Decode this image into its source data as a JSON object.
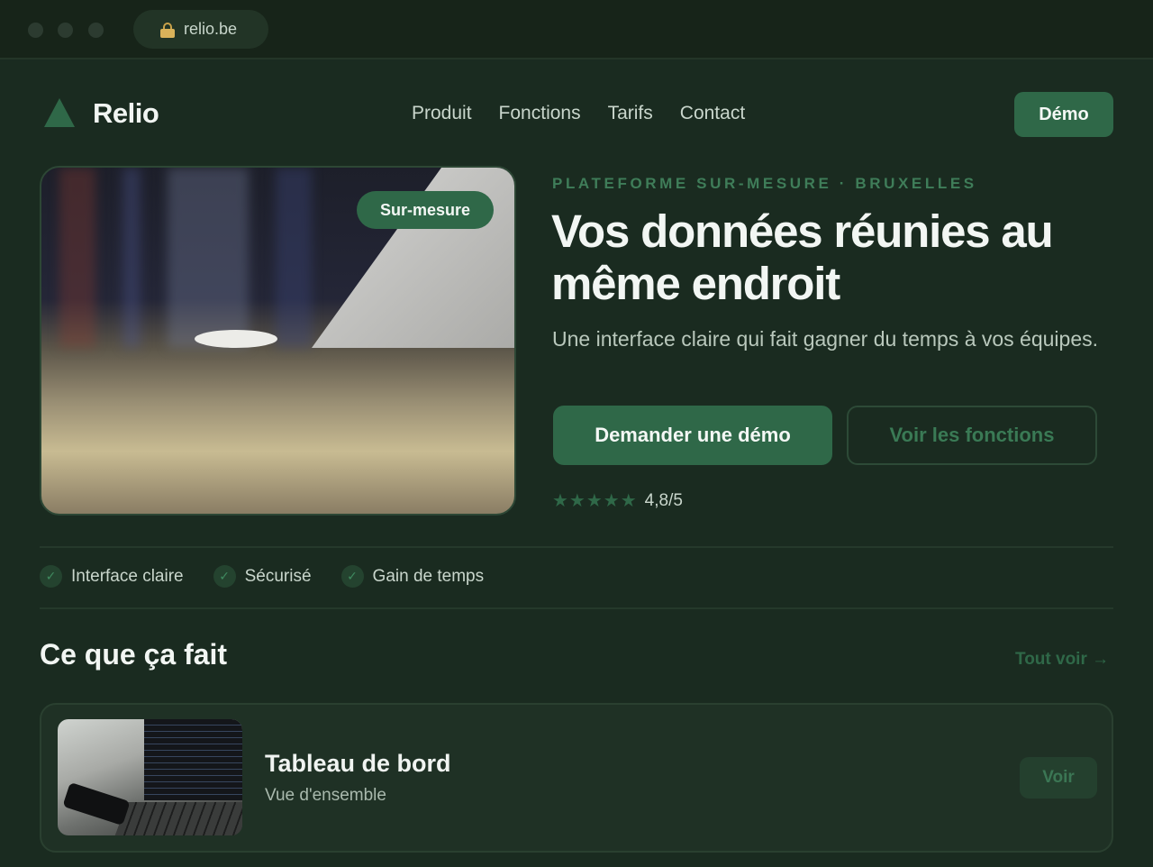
{
  "browser": {
    "url": "relio.be"
  },
  "nav": {
    "brand": "Relio",
    "links": [
      "Produit",
      "Fonctions",
      "Tarifs",
      "Contact"
    ],
    "cta": "Démo"
  },
  "hero": {
    "badge": "Sur-mesure",
    "eyebrow": "PLATEFORME SUR-MESURE · BRUXELLES",
    "headline": "Vos données réunies au même endroit",
    "subtitle": "Une interface claire qui fait gagner du temps à vos équipes.",
    "primary_cta": "Demander une démo",
    "secondary_cta": "Voir les fonctions",
    "stars": "★★★★★",
    "rating": "4,8/5"
  },
  "features": [
    "Interface claire",
    "Sécurisé",
    "Gain de temps"
  ],
  "section": {
    "title": "Ce que ça fait",
    "see_all": "Tout voir →",
    "cards": [
      {
        "title": "Tableau de bord",
        "subtitle": "Vue d'ensemble",
        "action": "Voir"
      }
    ]
  },
  "colors": {
    "background": "#1a2b20",
    "accent": "#2f6848",
    "accent_text": "#3f7d59"
  },
  "icons": {
    "logo": "triangle-logo-icon",
    "check": "check-icon",
    "lock": "lock-icon"
  }
}
